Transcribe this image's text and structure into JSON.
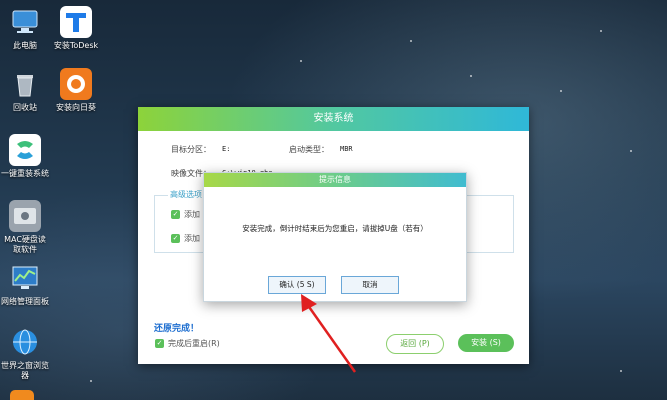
{
  "desktop": {
    "icons": [
      {
        "label": "此电脑",
        "icon": "computer-icon"
      },
      {
        "label": "安装ToDesk",
        "icon": "todesk-icon"
      },
      {
        "label": "回收站",
        "icon": "recycle-bin-icon"
      },
      {
        "label": "安装向日葵",
        "icon": "sunflower-icon"
      },
      {
        "label": "一键重装系统",
        "icon": "reinstall-icon"
      },
      {
        "label": "MAC硬盘读",
        "label2": "取软件",
        "icon": "mac-disk-icon"
      },
      {
        "label": "网络管理面板",
        "icon": "network-panel-icon"
      },
      {
        "label": "世界之窗浏览",
        "label2": "器",
        "icon": "browser-icon"
      }
    ]
  },
  "installer": {
    "title": "安装系统",
    "target_partition_label": "目标分区：",
    "target_partition_value": "E:",
    "boot_type_label": "启动类型：",
    "boot_type_value": "MBR",
    "image_file_label": "映像文件：",
    "image_file_value": "C:\\win10.gho",
    "advanced_label": "高级选项",
    "option1": "添加",
    "option2": "添加",
    "restore_done": "还原完成！",
    "auto_restart": "完成后重启(R)",
    "back_button": "返回 (P)",
    "install_button": "安装 (S)"
  },
  "dialog": {
    "title": "提示信息",
    "message": "安装完成，倒计时结束后为您重启，请拔掉U盘（若有）",
    "confirm_button": "确认 (5 S)",
    "cancel_button": "取消"
  },
  "colors": {
    "accent_green": "#5bc05a",
    "title_gradient_start": "#8dd33a",
    "title_gradient_end": "#2fb8d8",
    "arrow_red": "#e02020"
  }
}
